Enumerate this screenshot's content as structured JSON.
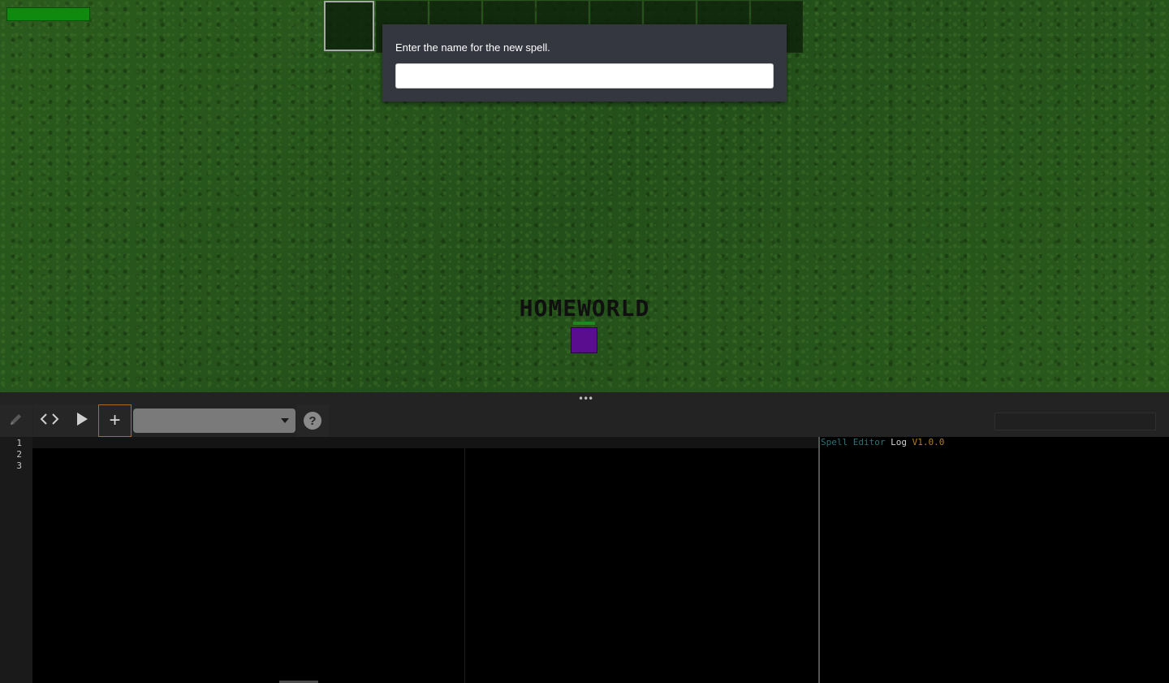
{
  "game": {
    "world_name": "HOMEWORLD",
    "player_health": 1.0,
    "hotbar_slots": 9,
    "selected_slot": 1
  },
  "dialog": {
    "prompt": "Enter the name for the new spell.",
    "input_value": "",
    "input_placeholder": ""
  },
  "toolbar": {
    "edit_icon": "pencil-icon",
    "code_icon": "code-brackets-icon",
    "run_icon": "play-icon",
    "add_label": "+",
    "spell_select_value": "",
    "help_label": "?"
  },
  "editor": {
    "line_numbers": [
      "1",
      "2",
      "3"
    ]
  },
  "log": {
    "title_words": [
      "Spell",
      "Editor",
      "Log",
      "V1.0.0"
    ]
  },
  "colors": {
    "accent_orange": "#b06a1c",
    "player": "#5a0d8f",
    "health": "#0f8a0f",
    "log_teal": "#2e6f74",
    "log_version": "#b07d1f"
  }
}
